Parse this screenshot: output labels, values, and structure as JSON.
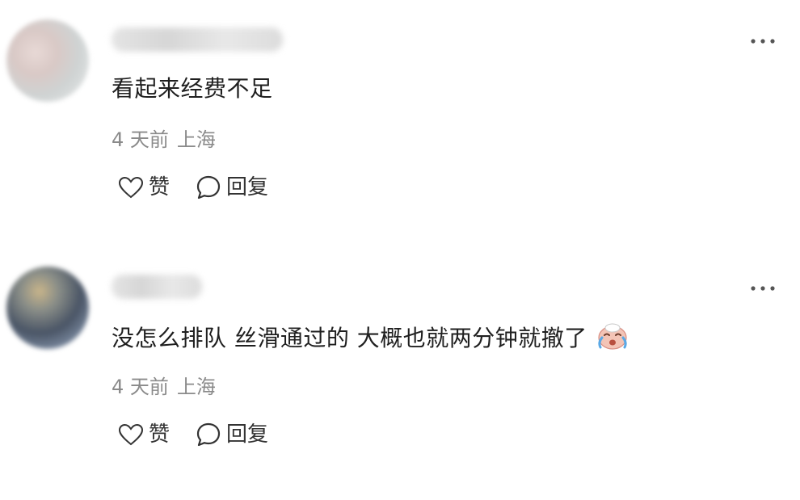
{
  "comments": [
    {
      "username": "",
      "text": "看起来经费不足",
      "time": "4 天前",
      "location": "上海",
      "like_label": "赞",
      "reply_label": "回复",
      "emoji": ""
    },
    {
      "username": "",
      "text": "没怎么排队 丝滑通过的 大概也就两分钟就撤了",
      "time": "4 天前",
      "location": "上海",
      "like_label": "赞",
      "reply_label": "回复",
      "emoji": "crying-face-icon"
    }
  ],
  "colors": {
    "text": "#1f1f1f",
    "meta": "#8a8a8a",
    "icon": "#333333"
  }
}
